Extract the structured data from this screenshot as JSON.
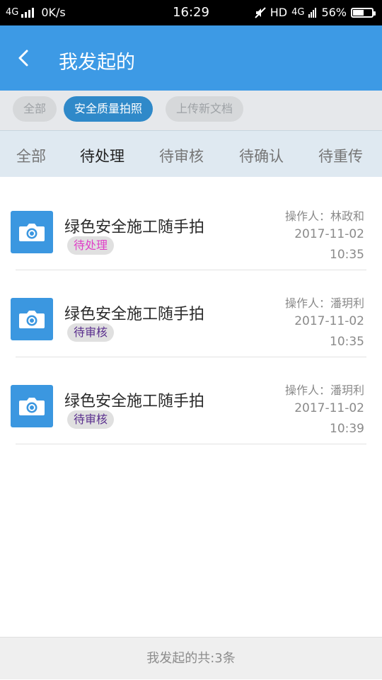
{
  "status_bar": {
    "network": "4G",
    "speed": "0K/s",
    "time": "16:29",
    "hd": "HD",
    "network2": "4G",
    "battery": "56%",
    "battery_level": 0.56
  },
  "header": {
    "back_icon": "chevron-left-icon",
    "title": "我发起的",
    "background": "#3d9ae5"
  },
  "filters": [
    {
      "label": "全部",
      "active": false
    },
    {
      "label": "安全质量拍照",
      "active": true
    },
    {
      "label": "上传新文档",
      "active": false
    }
  ],
  "tabs": [
    {
      "label": "全部",
      "active": false
    },
    {
      "label": "待处理",
      "active": true
    },
    {
      "label": "待审核",
      "active": false
    },
    {
      "label": "待确认",
      "active": false
    },
    {
      "label": "待重传",
      "active": false
    }
  ],
  "items": [
    {
      "icon": "camera-icon",
      "title": "绿色安全施工随手拍",
      "status": "待处理",
      "status_color": "#e040c8",
      "operator": "操作人：林政和",
      "date": "2017-11-02",
      "time": "10:35"
    },
    {
      "icon": "camera-icon",
      "title": "绿色安全施工随手拍",
      "status": "待审核",
      "status_color": "#5a2f8e",
      "operator": "操作人：潘玥利",
      "date": "2017-11-02",
      "time": "10:35"
    },
    {
      "icon": "camera-icon",
      "title": "绿色安全施工随手拍",
      "status": "待审核",
      "status_color": "#5a2f8e",
      "operator": "操作人：潘玥利",
      "date": "2017-11-02",
      "time": "10:39"
    }
  ],
  "footer": {
    "summary": "我发起的共:3条"
  }
}
